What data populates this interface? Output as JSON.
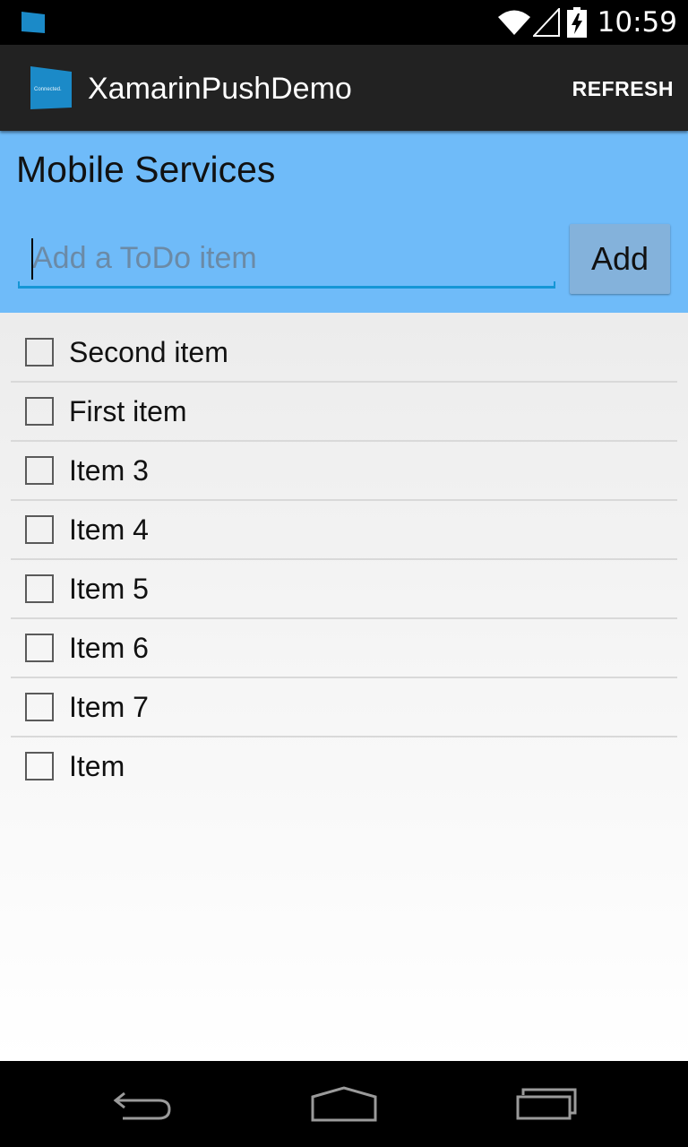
{
  "status_bar": {
    "time": "10:59",
    "icons": [
      "app-notification-icon",
      "wifi-icon",
      "signal-icon",
      "battery-charging-icon"
    ]
  },
  "action_bar": {
    "logo_text": "Connected.",
    "title": "XamarinPushDemo",
    "refresh_label": "REFRESH"
  },
  "header": {
    "title": "Mobile Services",
    "input_placeholder": "Add a ToDo item",
    "input_value": "",
    "add_label": "Add"
  },
  "todo_items": [
    {
      "label": "Second item",
      "checked": false
    },
    {
      "label": "First item",
      "checked": false
    },
    {
      "label": "Item 3",
      "checked": false
    },
    {
      "label": "Item 4",
      "checked": false
    },
    {
      "label": "Item 5",
      "checked": false
    },
    {
      "label": "Item 6",
      "checked": false
    },
    {
      "label": "Item 7",
      "checked": false
    },
    {
      "label": "Item",
      "checked": false
    }
  ],
  "nav_bar": {
    "icons": [
      "back-icon",
      "home-icon",
      "recent-apps-icon"
    ]
  },
  "colors": {
    "header_bg": "#6fbbf9",
    "action_bar_bg": "#222222",
    "accent": "#1596d6",
    "add_button_bg": "#84b2db"
  }
}
